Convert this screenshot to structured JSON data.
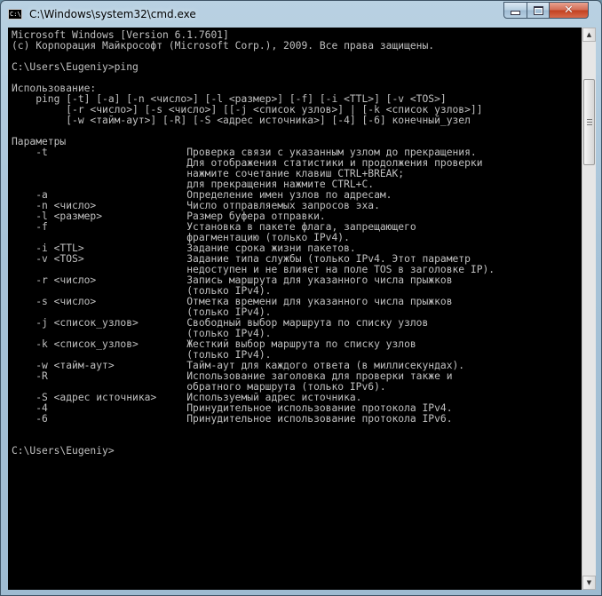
{
  "window": {
    "title": "C:\\Windows\\system32\\cmd.exe",
    "icon_text": "C:\\",
    "controls": {
      "minimize_icon": "minimize-icon",
      "maximize_icon": "maximize-icon",
      "close_icon": "close-icon",
      "close_glyph": "✕"
    }
  },
  "console": {
    "lines": [
      "Microsoft Windows [Version 6.1.7601]",
      "(c) Корпорация Майкрософт (Microsoft Corp.), 2009. Все права защищены.",
      "",
      "C:\\Users\\Eugeniy>ping",
      "",
      "Использование:",
      "    ping [-t] [-a] [-n <число>] [-l <размер>] [-f] [-i <TTL>] [-v <TOS>]",
      "         [-r <число>] [-s <число>] [[-j <список узлов>] | [-k <список узлов>]]",
      "         [-w <тайм-аут>] [-R] [-S <адрес источника>] [-4] [-6] конечный_узел",
      "",
      "Параметры",
      "    -t                       Проверка связи с указанным узлом до прекращения.",
      "                             Для отображения статистики и продолжения проверки",
      "                             нажмите сочетание клавиш CTRL+BREAK;",
      "                             для прекращения нажмите CTRL+C.",
      "    -a                       Определение имен узлов по адресам.",
      "    -n <число>               Число отправляемых запросов эха.",
      "    -l <размер>              Размер буфера отправки.",
      "    -f                       Установка в пакете флага, запрещающего",
      "                             фрагментацию (только IPv4).",
      "    -i <TTL>                 Задание срока жизни пакетов.",
      "    -v <TOS>                 Задание типа службы (только IPv4. Этот параметр",
      "                             недоступен и не влияет на поле TOS в заголовке IP).",
      "    -r <число>               Запись маршрута для указанного числа прыжков",
      "                             (только IPv4).",
      "    -s <число>               Отметка времени для указанного числа прыжков",
      "                             (только IPv4).",
      "    -j <список_узлов>        Свободный выбор маршрута по списку узлов",
      "                             (только IPv4).",
      "    -k <список_узлов>        Жесткий выбор маршрута по списку узлов",
      "                             (только IPv4).",
      "    -w <тайм-аут>            Тайм-аут для каждого ответа (в миллисекундах).",
      "    -R                       Использование заголовка для проверки также и",
      "                             обратного маршрута (только IPv6).",
      "    -S <адрес источника>     Используемый адрес источника.",
      "    -4                       Принудительное использование протокола IPv4.",
      "    -6                       Принудительное использование протокола IPv6.",
      "",
      "",
      "C:\\Users\\Eugeniy>"
    ]
  },
  "scrollbar": {
    "up_arrow": "▲",
    "down_arrow": "▼"
  },
  "colors": {
    "console_bg": "#000000",
    "console_fg": "#c0c0c0",
    "close_button": "#c2401f"
  }
}
